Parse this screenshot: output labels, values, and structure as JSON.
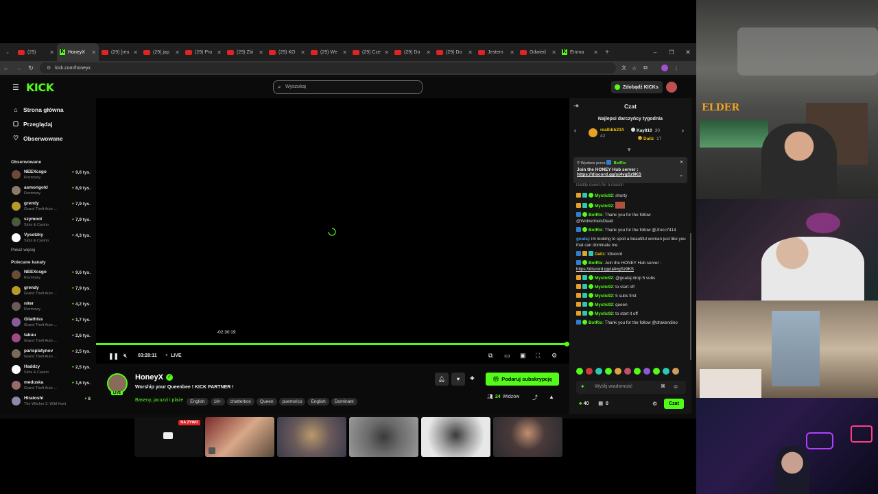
{
  "browser": {
    "tabs": [
      {
        "label": "(29) ",
        "kind": "yt"
      },
      {
        "label": "HoneyX",
        "kind": "kick",
        "active": true
      },
      {
        "label": "(29) [reu",
        "kind": "yt"
      },
      {
        "label": "(29) jap",
        "kind": "yt"
      },
      {
        "label": "(29) Pro",
        "kind": "yt"
      },
      {
        "label": "(29) Zbi",
        "kind": "yt"
      },
      {
        "label": "(29) KO",
        "kind": "yt"
      },
      {
        "label": "(29) We",
        "kind": "yt"
      },
      {
        "label": "(29) Cze",
        "kind": "yt"
      },
      {
        "label": "(29) Do",
        "kind": "yt"
      },
      {
        "label": "(29) Do",
        "kind": "yt"
      },
      {
        "label": "Jestem",
        "kind": "yt"
      },
      {
        "label": "Odwied",
        "kind": "yt"
      },
      {
        "label": "Emma",
        "kind": "kick"
      }
    ],
    "url": "kick.com/honeyx"
  },
  "header": {
    "logo": "KICK",
    "search_placeholder": "Wyszukaj",
    "kicks_button": "Zdobądź KICKs"
  },
  "sidebar": {
    "nav": [
      {
        "label": "Strona główna",
        "icon": "home-icon"
      },
      {
        "label": "Przeglądaj",
        "icon": "browse-icon"
      },
      {
        "label": "Obserwowane",
        "icon": "heart-icon"
      }
    ],
    "followed_title": "Obserwowane",
    "followed": [
      {
        "name": "NEEXcsgo",
        "category": "Rozmowy",
        "viewers": "9,6 tys.",
        "color": "#6b4a3a"
      },
      {
        "name": "asmongold",
        "category": "Rozmowy",
        "viewers": "8,9 tys.",
        "color": "#8a7a6a"
      },
      {
        "name": "grendy",
        "category": "Grand Theft Auto ...",
        "viewers": "7,9 tys.",
        "color": "#b79a2a"
      },
      {
        "name": "szymool",
        "category": "Slots & Casino",
        "viewers": "7,9 tys.",
        "color": "#4a5a3a"
      },
      {
        "name": "Vysotzky",
        "category": "Slots & Casino",
        "viewers": "4,3 tys.",
        "color": "#ffffff"
      }
    ],
    "show_more": "Pokaż więcej",
    "recommended_title": "Polecane kanały",
    "recommended": [
      {
        "name": "NEEXcsgo",
        "category": "Rozmowy",
        "viewers": "9,6 tys.",
        "color": "#6b4a3a"
      },
      {
        "name": "grendy",
        "category": "Grand Theft Auto ...",
        "viewers": "7,9 tys.",
        "color": "#b79a2a"
      },
      {
        "name": "niter",
        "category": "Rozmowy",
        "viewers": "4,2 tys.",
        "color": "#6a5a5a"
      },
      {
        "name": "Gilathiss",
        "category": "Grand Theft Auto ...",
        "viewers": "1,7 tys.",
        "color": "#8a5a9a"
      },
      {
        "name": "takuu",
        "category": "Grand Theft Auto ...",
        "viewers": "2,6 tys.",
        "color": "#a04a8a"
      },
      {
        "name": "parisplatynov",
        "category": "Grand Theft Auto ...",
        "viewers": "2,5 tys.",
        "color": "#7a6a5a"
      },
      {
        "name": "Haddzy",
        "category": "Slots & Casino",
        "viewers": "2,5 tys.",
        "color": "#ffffff"
      },
      {
        "name": "meduska",
        "category": "Grand Theft Auto ...",
        "viewers": "1,6 tys.",
        "color": "#9a6a6a"
      },
      {
        "name": "Hiratoshi",
        "category": "The Witcher 3: Wild Hunt",
        "viewers": "8",
        "color": "#8a8aaa"
      }
    ]
  },
  "player": {
    "seek_tooltip": "-02:30:19",
    "time": "03:28:11",
    "live": "LIVE",
    "progress": 1.0
  },
  "stream": {
    "channel": "HoneyX",
    "live_badge": "LIVE",
    "title": "Worship your Queenbee ! KICK PARTNER !",
    "category": "Baseny, jacuzzi i plaże",
    "tags": [
      "English",
      "18+",
      "chatterbox",
      "Queen",
      "puertorico",
      "English",
      "Dominant"
    ],
    "subscribe_button": "Podaruj subskrypcję",
    "viewers_count": "24",
    "viewers_label": "Widzów"
  },
  "chat": {
    "title": "Czat",
    "gifters_title": "Najlepsi darczyńcy tygodnia",
    "gifters": [
      {
        "name": "realbbb234",
        "count": "42"
      },
      {
        "name": "Kay810",
        "count": "30"
      },
      {
        "name": "Daliz",
        "count": "17"
      }
    ],
    "pinned_by_label": "Wysłane przez",
    "pinned_by": "BotRix",
    "pinned_text": "Join the HONEY Hub server :",
    "pinned_link": "https://discord.gg/uj4vgSz9KS",
    "partial_line": "Daddy queen for a reason",
    "messages": [
      {
        "user": "Mystic92",
        "text": "shorty",
        "badges": [
          "crown",
          "teal",
          "vip"
        ],
        "ucls": ""
      },
      {
        "user": "Mystic92",
        "text": "",
        "badges": [
          "crown",
          "teal",
          "vip"
        ],
        "ucls": "",
        "emote": true
      },
      {
        "user": "BotRix",
        "text": "Thank you for the follow @WolverineisDead",
        "badges": [
          "blue",
          "vip"
        ],
        "ucls": ""
      },
      {
        "user": "BotRix",
        "text": "Thank you for the follow @Jrocc7414",
        "badges": [
          "blue",
          "vip"
        ],
        "ucls": ""
      },
      {
        "user": "goataj",
        "text": "im looking to spoil a beautiful woman just like you that can dominate me",
        "badges": [],
        "ucls": "blue"
      },
      {
        "user": "Daliz",
        "text": "!discord",
        "badges": [
          "blue",
          "crown",
          "teal"
        ],
        "ucls": "gold"
      },
      {
        "user": "BotRix",
        "text": "Join the HONEY Hub server : ",
        "link": "https://discord.gg/uj4vgSz9KS",
        "badges": [
          "blue",
          "vip"
        ],
        "ucls": ""
      },
      {
        "user": "Mystic92",
        "text": "@goataj drop 5 subs",
        "badges": [
          "crown",
          "teal",
          "vip"
        ],
        "ucls": ""
      },
      {
        "user": "Mystic92",
        "text": "to start off",
        "badges": [
          "crown",
          "teal",
          "vip"
        ],
        "ucls": ""
      },
      {
        "user": "Mystic92",
        "text": "5 subs first",
        "badges": [
          "crown",
          "teal",
          "vip"
        ],
        "ucls": ""
      },
      {
        "user": "Mystic92",
        "text": "queen",
        "badges": [
          "crown",
          "teal",
          "vip"
        ],
        "ucls": ""
      },
      {
        "user": "Mystic92",
        "text": "to start it off",
        "badges": [
          "crown",
          "teal",
          "vip"
        ],
        "ucls": ""
      },
      {
        "user": "BotRix",
        "text": "Thank you for the follow @drakendino",
        "badges": [
          "blue",
          "vip"
        ],
        "ucls": ""
      }
    ],
    "input_placeholder": "Wyślij wiadomość",
    "points": "40",
    "gifts": "0",
    "send_button": "Czat"
  },
  "thumbnails": {
    "live_label": "NA ŻYWO"
  },
  "overlay": {
    "elder_label": "ELDER"
  }
}
